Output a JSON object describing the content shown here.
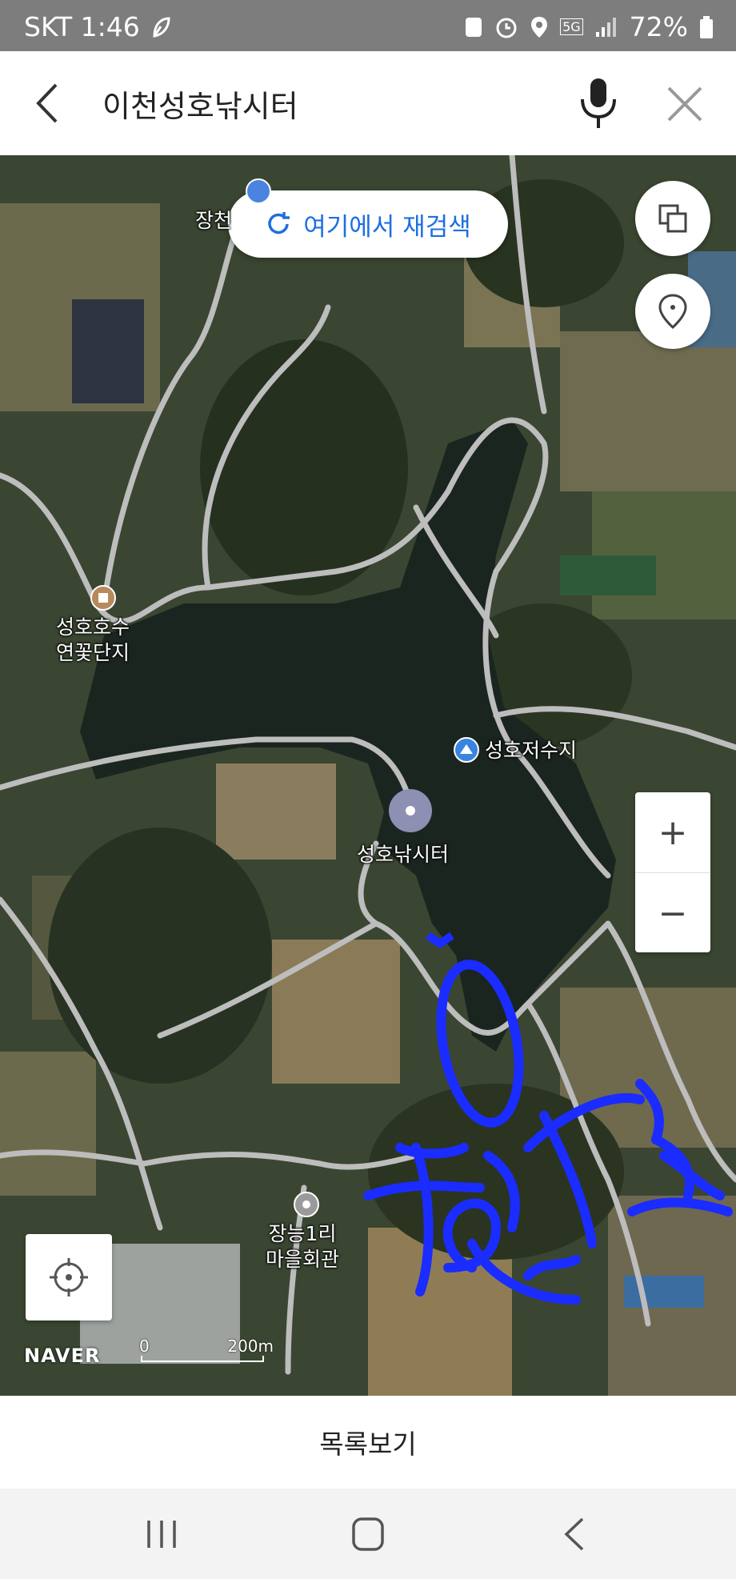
{
  "status_bar": {
    "carrier_time": "SKT 1:46",
    "battery": "72%",
    "network": "5G"
  },
  "search": {
    "query": "이천성호낚시터"
  },
  "map": {
    "research_button": "여기에서 재검색",
    "layer_icon": "layers-icon",
    "pin_icon": "location-pin-icon",
    "zoom_in": "+",
    "zoom_out": "−",
    "labels": {
      "poi_partial": "장천",
      "lotus_park": [
        "성호호수",
        "연꽃단지"
      ],
      "reservoir": "성호저수지",
      "fishing_spot": "성호낚시터",
      "village_hall": [
        "장능1리",
        "마을회관"
      ]
    },
    "logo": "NAVER",
    "scale": {
      "start": "0",
      "end": "200m"
    },
    "annotation_color": "#1a2cff",
    "water_color": "#1b2520",
    "road_color": "#bdbdbd"
  },
  "bottom": {
    "list_view": "목록보기"
  },
  "nav": {
    "recent": "recent-apps-icon",
    "home": "home-icon",
    "back": "back-icon"
  }
}
